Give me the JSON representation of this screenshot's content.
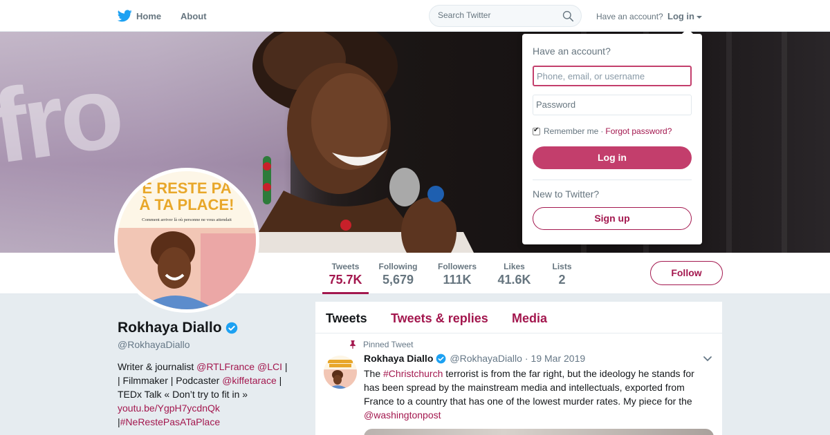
{
  "nav": {
    "home_label": "Home",
    "about_label": "About",
    "search_placeholder": "Search Twitter",
    "have_account_text": "Have an account?",
    "login_label": "Log in",
    "icons": [
      "twitter-bird-icon",
      "search-icon",
      "caret-down-icon"
    ]
  },
  "login_dropdown": {
    "title": "Have an account?",
    "username_placeholder": "Phone, email, or username",
    "password_placeholder": "Password",
    "remember_label": "Remember me",
    "separator": "·",
    "forgot_label": "Forgot password?",
    "login_button": "Log in",
    "new_text": "New to Twitter?",
    "signup_button": "Sign up",
    "remember_checked": true
  },
  "banner": {
    "backdrop_text": "fro"
  },
  "stats": [
    {
      "label": "Tweets",
      "value": "75.7K",
      "active": true
    },
    {
      "label": "Following",
      "value": "5,679",
      "active": false
    },
    {
      "label": "Followers",
      "value": "111K",
      "active": false
    },
    {
      "label": "Likes",
      "value": "41.6K",
      "active": false
    },
    {
      "label": "Lists",
      "value": "2",
      "active": false
    }
  ],
  "follow_button": "Follow",
  "profile": {
    "name": "Rokhaya Diallo",
    "handle": "@RokhayaDiallo",
    "avatar_book_title_1": "E RESTE PA",
    "avatar_book_title_2": "À TA PLACE!",
    "avatar_book_subtitle": "Comment arriver là où personne ne vous attendait",
    "bio": {
      "t1": "Writer & journalist ",
      "l1": "@RTLFrance",
      "t2": " ",
      "l2": "@LCI",
      "t3": " | | Filmmaker | Podcaster ",
      "l3": "@kiffetarace",
      "t4": " | TEDx Talk « Don’t try to fit in » ",
      "l4": "youtu.be/YgpH7ycdnQk",
      "t5": " |",
      "l5": "#NeRestePasATaPlace"
    }
  },
  "timeline": {
    "tabs": [
      "Tweets",
      "Tweets & replies",
      "Media"
    ],
    "pinned_label": "Pinned Tweet",
    "tweet": {
      "name": "Rokhaya Diallo",
      "handle": "@RokhayaDiallo",
      "dot": "·",
      "date": "19 Mar 2019",
      "text_1": "The ",
      "hashtag": "#Christchurch",
      "text_2": " terrorist is from the far right, but the ideology he stands for has been spread by the mainstream media and intellectuals, exported from France to a country that has one of the lowest murder rates. My piece for the ",
      "mention": "@washingtonpost"
    }
  },
  "colors": {
    "accent": "#a3174e",
    "login_button": "#c33e6c",
    "verified": "#1da1f2",
    "twitter_blue": "#1da1f2"
  }
}
